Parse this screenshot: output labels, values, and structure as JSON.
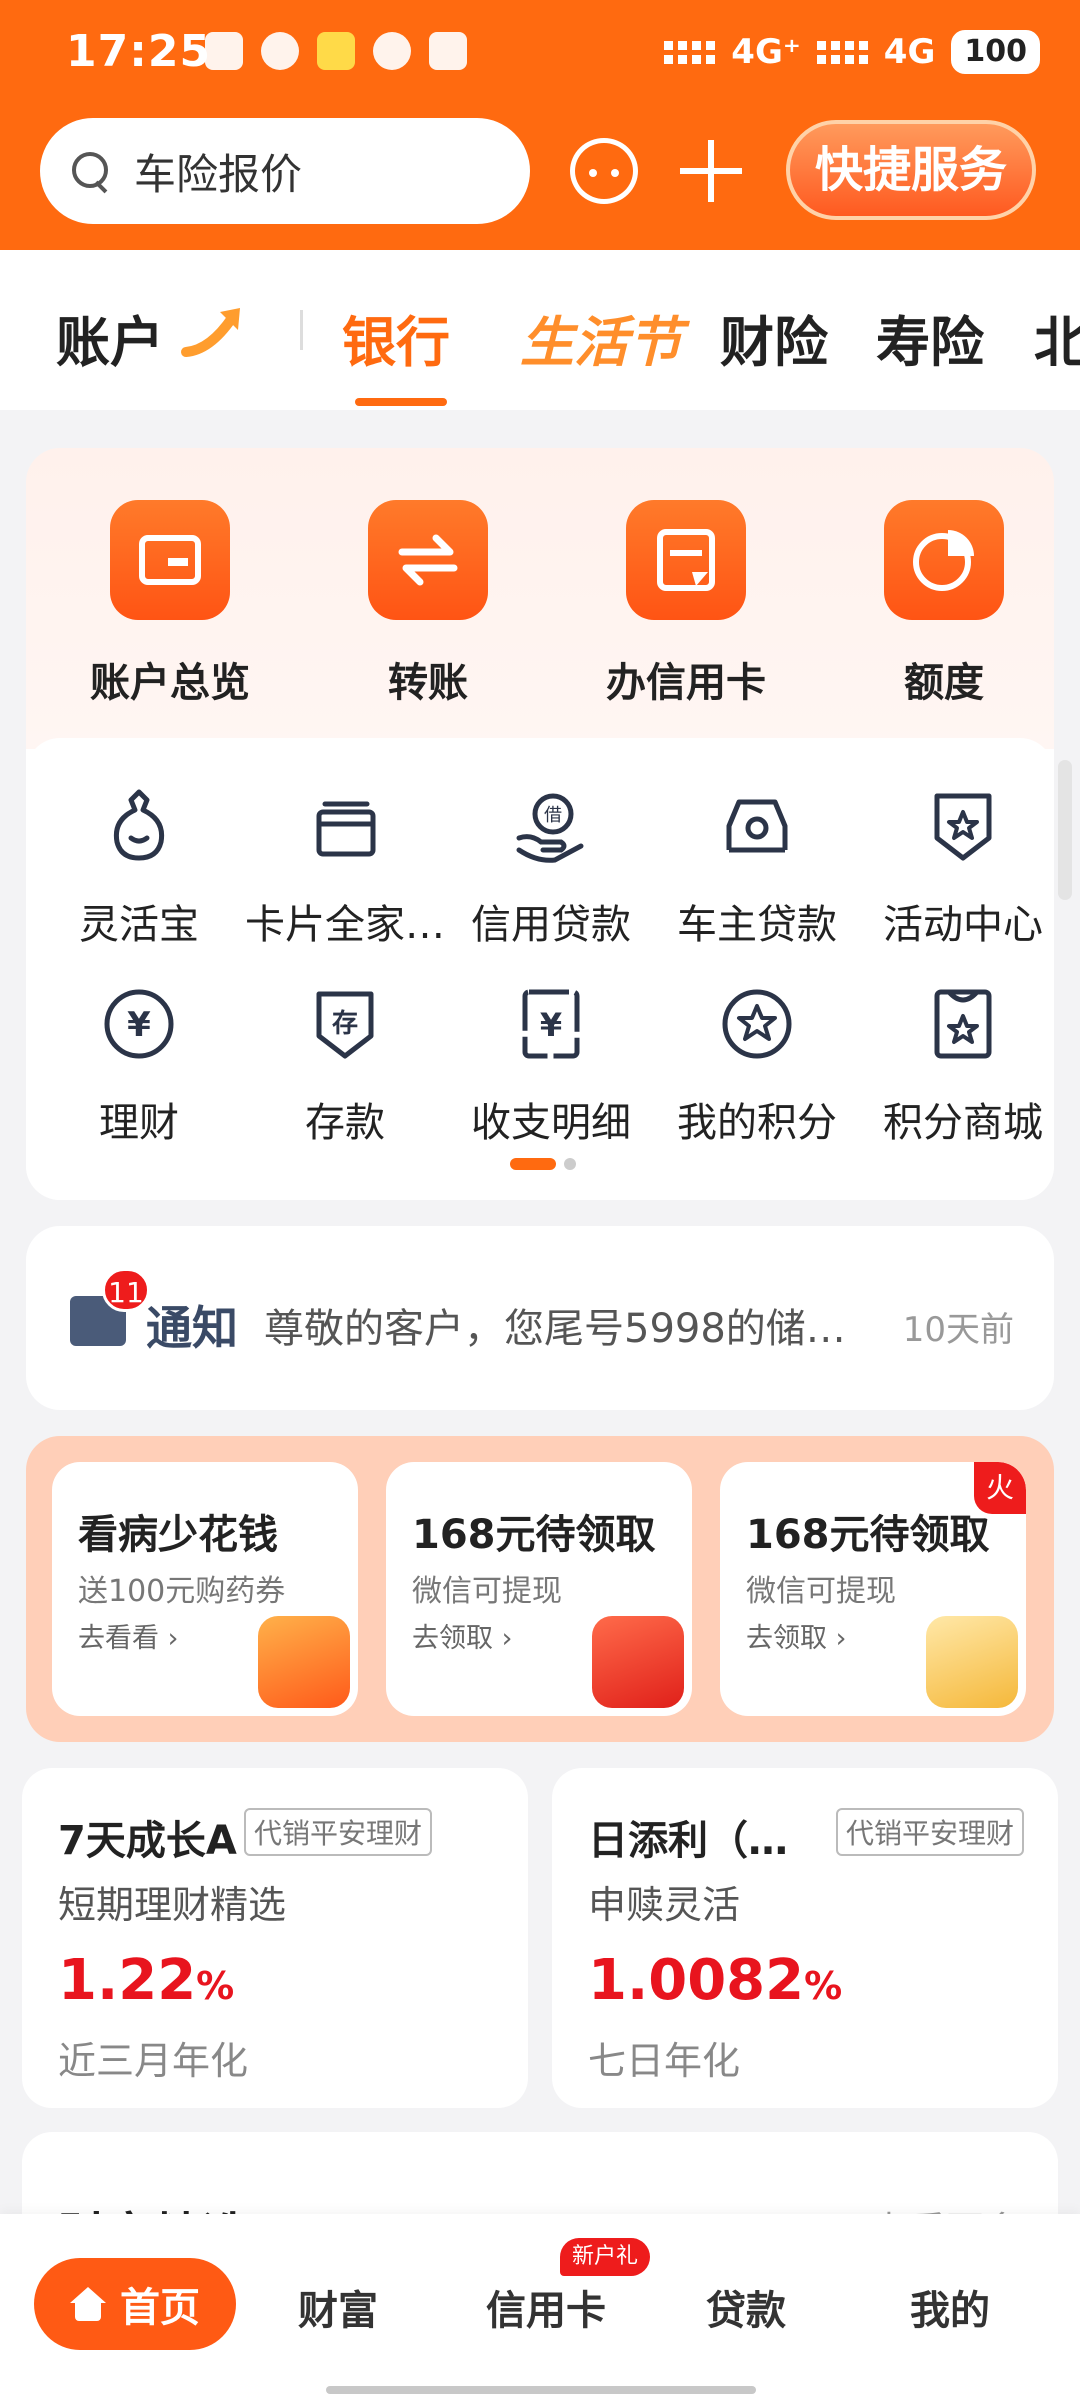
{
  "status_bar": {
    "time": "17:25",
    "network_left": "4G⁺",
    "network_right": "4G",
    "battery": "100"
  },
  "header": {
    "search_placeholder": "车险报价",
    "quick_service": "快捷服务"
  },
  "top_tabs": {
    "account": "账户",
    "items": [
      "银行",
      "生活节",
      "财险",
      "寿险",
      "北"
    ],
    "active": "银行"
  },
  "quick_actions": [
    {
      "label": "账户总览",
      "icon": "wallet-icon"
    },
    {
      "label": "转账",
      "icon": "transfer-icon"
    },
    {
      "label": "办信用卡",
      "icon": "credit-card-apply-icon"
    },
    {
      "label": "额度",
      "icon": "pie-chart-icon"
    }
  ],
  "services": [
    {
      "label": "灵活宝",
      "icon": "money-bag-icon"
    },
    {
      "label": "卡片全家…",
      "icon": "card-stack-icon"
    },
    {
      "label": "信用贷款",
      "icon": "loan-hand-icon"
    },
    {
      "label": "车主贷款",
      "icon": "car-icon"
    },
    {
      "label": "活动中心",
      "icon": "star-shield-icon"
    },
    {
      "label": "理财",
      "icon": "yuan-circle-icon"
    },
    {
      "label": "存款",
      "icon": "deposit-icon"
    },
    {
      "label": "收支明细",
      "icon": "statement-icon"
    },
    {
      "label": "我的积分",
      "icon": "points-star-icon"
    },
    {
      "label": "积分商城",
      "icon": "points-mall-icon"
    }
  ],
  "notice": {
    "badge": "11",
    "title": "通知",
    "text": "尊敬的客户，您尾号5998的储…",
    "time": "10天前"
  },
  "promos": [
    {
      "title": "看病少花钱",
      "subtitle": "送100元购药券",
      "link": "去看看 ›",
      "hot": false
    },
    {
      "title": "168元待领取",
      "subtitle": "微信可提现",
      "link": "去领取 ›",
      "hot": false
    },
    {
      "title": "168元待领取",
      "subtitle": "微信可提现",
      "link": "去领取 ›",
      "hot": true
    }
  ],
  "hot_label": "火",
  "products": [
    {
      "name": "7天成长A",
      "tag": "代销平安理财",
      "desc": "短期理财精选",
      "rate": "1.22",
      "unit": "%",
      "rate_label": "近三月年化"
    },
    {
      "name": "日添利（…",
      "tag": "代销平安理财",
      "desc": "申赎灵活",
      "rate": "1.0082",
      "unit": "%",
      "rate_label": "七日年化"
    }
  ],
  "wealth": {
    "title": "财富精选",
    "more": "查看更多"
  },
  "bottom_nav": {
    "items": [
      "首页",
      "财富",
      "信用卡",
      "贷款",
      "我的"
    ],
    "active": "首页",
    "badge": "新户礼"
  },
  "colors": {
    "brand": "#ff6a10",
    "accent_red": "#e8141e",
    "icon_dark": "#2b3448"
  }
}
